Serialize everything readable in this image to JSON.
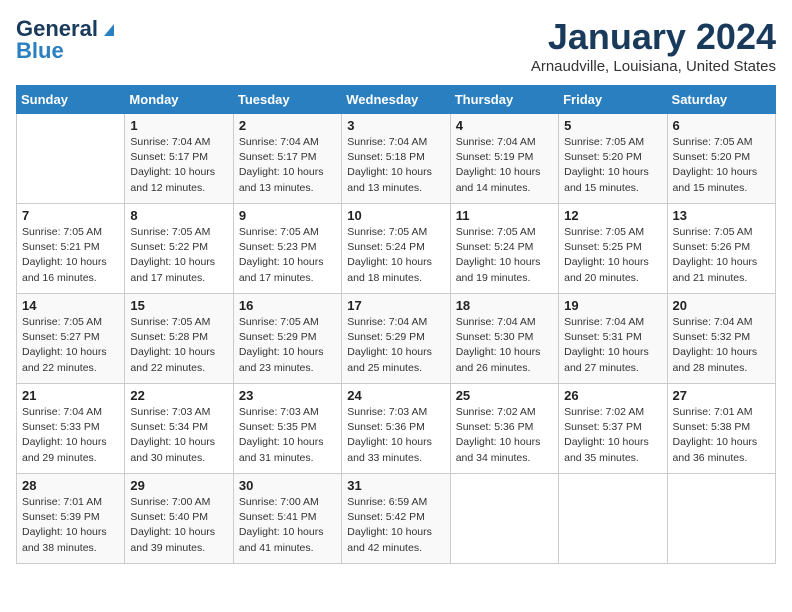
{
  "header": {
    "logo_line1": "General",
    "logo_line2": "Blue",
    "month": "January 2024",
    "location": "Arnaudville, Louisiana, United States"
  },
  "weekdays": [
    "Sunday",
    "Monday",
    "Tuesday",
    "Wednesday",
    "Thursday",
    "Friday",
    "Saturday"
  ],
  "weeks": [
    [
      {
        "day": "",
        "sunrise": "",
        "sunset": "",
        "daylight": ""
      },
      {
        "day": "1",
        "sunrise": "Sunrise: 7:04 AM",
        "sunset": "Sunset: 5:17 PM",
        "daylight": "Daylight: 10 hours and 12 minutes."
      },
      {
        "day": "2",
        "sunrise": "Sunrise: 7:04 AM",
        "sunset": "Sunset: 5:17 PM",
        "daylight": "Daylight: 10 hours and 13 minutes."
      },
      {
        "day": "3",
        "sunrise": "Sunrise: 7:04 AM",
        "sunset": "Sunset: 5:18 PM",
        "daylight": "Daylight: 10 hours and 13 minutes."
      },
      {
        "day": "4",
        "sunrise": "Sunrise: 7:04 AM",
        "sunset": "Sunset: 5:19 PM",
        "daylight": "Daylight: 10 hours and 14 minutes."
      },
      {
        "day": "5",
        "sunrise": "Sunrise: 7:05 AM",
        "sunset": "Sunset: 5:20 PM",
        "daylight": "Daylight: 10 hours and 15 minutes."
      },
      {
        "day": "6",
        "sunrise": "Sunrise: 7:05 AM",
        "sunset": "Sunset: 5:20 PM",
        "daylight": "Daylight: 10 hours and 15 minutes."
      }
    ],
    [
      {
        "day": "7",
        "sunrise": "Sunrise: 7:05 AM",
        "sunset": "Sunset: 5:21 PM",
        "daylight": "Daylight: 10 hours and 16 minutes."
      },
      {
        "day": "8",
        "sunrise": "Sunrise: 7:05 AM",
        "sunset": "Sunset: 5:22 PM",
        "daylight": "Daylight: 10 hours and 17 minutes."
      },
      {
        "day": "9",
        "sunrise": "Sunrise: 7:05 AM",
        "sunset": "Sunset: 5:23 PM",
        "daylight": "Daylight: 10 hours and 17 minutes."
      },
      {
        "day": "10",
        "sunrise": "Sunrise: 7:05 AM",
        "sunset": "Sunset: 5:24 PM",
        "daylight": "Daylight: 10 hours and 18 minutes."
      },
      {
        "day": "11",
        "sunrise": "Sunrise: 7:05 AM",
        "sunset": "Sunset: 5:24 PM",
        "daylight": "Daylight: 10 hours and 19 minutes."
      },
      {
        "day": "12",
        "sunrise": "Sunrise: 7:05 AM",
        "sunset": "Sunset: 5:25 PM",
        "daylight": "Daylight: 10 hours and 20 minutes."
      },
      {
        "day": "13",
        "sunrise": "Sunrise: 7:05 AM",
        "sunset": "Sunset: 5:26 PM",
        "daylight": "Daylight: 10 hours and 21 minutes."
      }
    ],
    [
      {
        "day": "14",
        "sunrise": "Sunrise: 7:05 AM",
        "sunset": "Sunset: 5:27 PM",
        "daylight": "Daylight: 10 hours and 22 minutes."
      },
      {
        "day": "15",
        "sunrise": "Sunrise: 7:05 AM",
        "sunset": "Sunset: 5:28 PM",
        "daylight": "Daylight: 10 hours and 22 minutes."
      },
      {
        "day": "16",
        "sunrise": "Sunrise: 7:05 AM",
        "sunset": "Sunset: 5:29 PM",
        "daylight": "Daylight: 10 hours and 23 minutes."
      },
      {
        "day": "17",
        "sunrise": "Sunrise: 7:04 AM",
        "sunset": "Sunset: 5:29 PM",
        "daylight": "Daylight: 10 hours and 25 minutes."
      },
      {
        "day": "18",
        "sunrise": "Sunrise: 7:04 AM",
        "sunset": "Sunset: 5:30 PM",
        "daylight": "Daylight: 10 hours and 26 minutes."
      },
      {
        "day": "19",
        "sunrise": "Sunrise: 7:04 AM",
        "sunset": "Sunset: 5:31 PM",
        "daylight": "Daylight: 10 hours and 27 minutes."
      },
      {
        "day": "20",
        "sunrise": "Sunrise: 7:04 AM",
        "sunset": "Sunset: 5:32 PM",
        "daylight": "Daylight: 10 hours and 28 minutes."
      }
    ],
    [
      {
        "day": "21",
        "sunrise": "Sunrise: 7:04 AM",
        "sunset": "Sunset: 5:33 PM",
        "daylight": "Daylight: 10 hours and 29 minutes."
      },
      {
        "day": "22",
        "sunrise": "Sunrise: 7:03 AM",
        "sunset": "Sunset: 5:34 PM",
        "daylight": "Daylight: 10 hours and 30 minutes."
      },
      {
        "day": "23",
        "sunrise": "Sunrise: 7:03 AM",
        "sunset": "Sunset: 5:35 PM",
        "daylight": "Daylight: 10 hours and 31 minutes."
      },
      {
        "day": "24",
        "sunrise": "Sunrise: 7:03 AM",
        "sunset": "Sunset: 5:36 PM",
        "daylight": "Daylight: 10 hours and 33 minutes."
      },
      {
        "day": "25",
        "sunrise": "Sunrise: 7:02 AM",
        "sunset": "Sunset: 5:36 PM",
        "daylight": "Daylight: 10 hours and 34 minutes."
      },
      {
        "day": "26",
        "sunrise": "Sunrise: 7:02 AM",
        "sunset": "Sunset: 5:37 PM",
        "daylight": "Daylight: 10 hours and 35 minutes."
      },
      {
        "day": "27",
        "sunrise": "Sunrise: 7:01 AM",
        "sunset": "Sunset: 5:38 PM",
        "daylight": "Daylight: 10 hours and 36 minutes."
      }
    ],
    [
      {
        "day": "28",
        "sunrise": "Sunrise: 7:01 AM",
        "sunset": "Sunset: 5:39 PM",
        "daylight": "Daylight: 10 hours and 38 minutes."
      },
      {
        "day": "29",
        "sunrise": "Sunrise: 7:00 AM",
        "sunset": "Sunset: 5:40 PM",
        "daylight": "Daylight: 10 hours and 39 minutes."
      },
      {
        "day": "30",
        "sunrise": "Sunrise: 7:00 AM",
        "sunset": "Sunset: 5:41 PM",
        "daylight": "Daylight: 10 hours and 41 minutes."
      },
      {
        "day": "31",
        "sunrise": "Sunrise: 6:59 AM",
        "sunset": "Sunset: 5:42 PM",
        "daylight": "Daylight: 10 hours and 42 minutes."
      },
      {
        "day": "",
        "sunrise": "",
        "sunset": "",
        "daylight": ""
      },
      {
        "day": "",
        "sunrise": "",
        "sunset": "",
        "daylight": ""
      },
      {
        "day": "",
        "sunrise": "",
        "sunset": "",
        "daylight": ""
      }
    ]
  ]
}
